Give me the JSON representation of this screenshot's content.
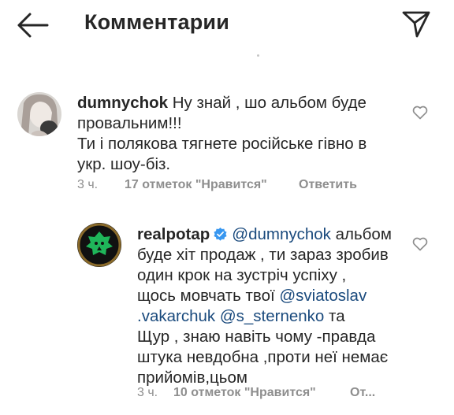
{
  "header": {
    "title": "Комментарии",
    "back_icon": "arrow-left-icon",
    "share_icon": "paper-plane-icon"
  },
  "comments": [
    {
      "username": "dumnychok",
      "lines": [
        "Ну знай , шо альбом буде",
        "провальним!!!",
        "Ти і полякова тягнете російське гівно в",
        "укр. шоу-біз."
      ],
      "time": "3 ч.",
      "likes": "17 отметок \"Нравится\"",
      "reply": "Ответить"
    },
    {
      "username": "realpotap",
      "verified": true,
      "mention_first": "@dumnychok",
      "line1_rest": " альбом",
      "line2": "буде хіт продаж , ти зараз зробив",
      "line3": "один крок на зустріч успіху ,",
      "line4_pre": "щось мовчать твої ",
      "mention_2a": "@sviatoslav",
      "mention_2b": ".vakarchuk",
      "line5_sep": " ",
      "mention_3": "@s_sternenko",
      "line5_post": " та",
      "line6": "Щур , знаю навіть чому -правда",
      "line7": "штука невдобна ,проти неї немає",
      "line8": "прийомів,цьом",
      "time": "3 ч.",
      "likes": "10 отметок \"Нравится\"",
      "reply": "От..."
    }
  ],
  "colors": {
    "text": "#262626",
    "meta": "#8e8e8e",
    "mention": "#1a4a7d",
    "verified": "#3897f0"
  }
}
